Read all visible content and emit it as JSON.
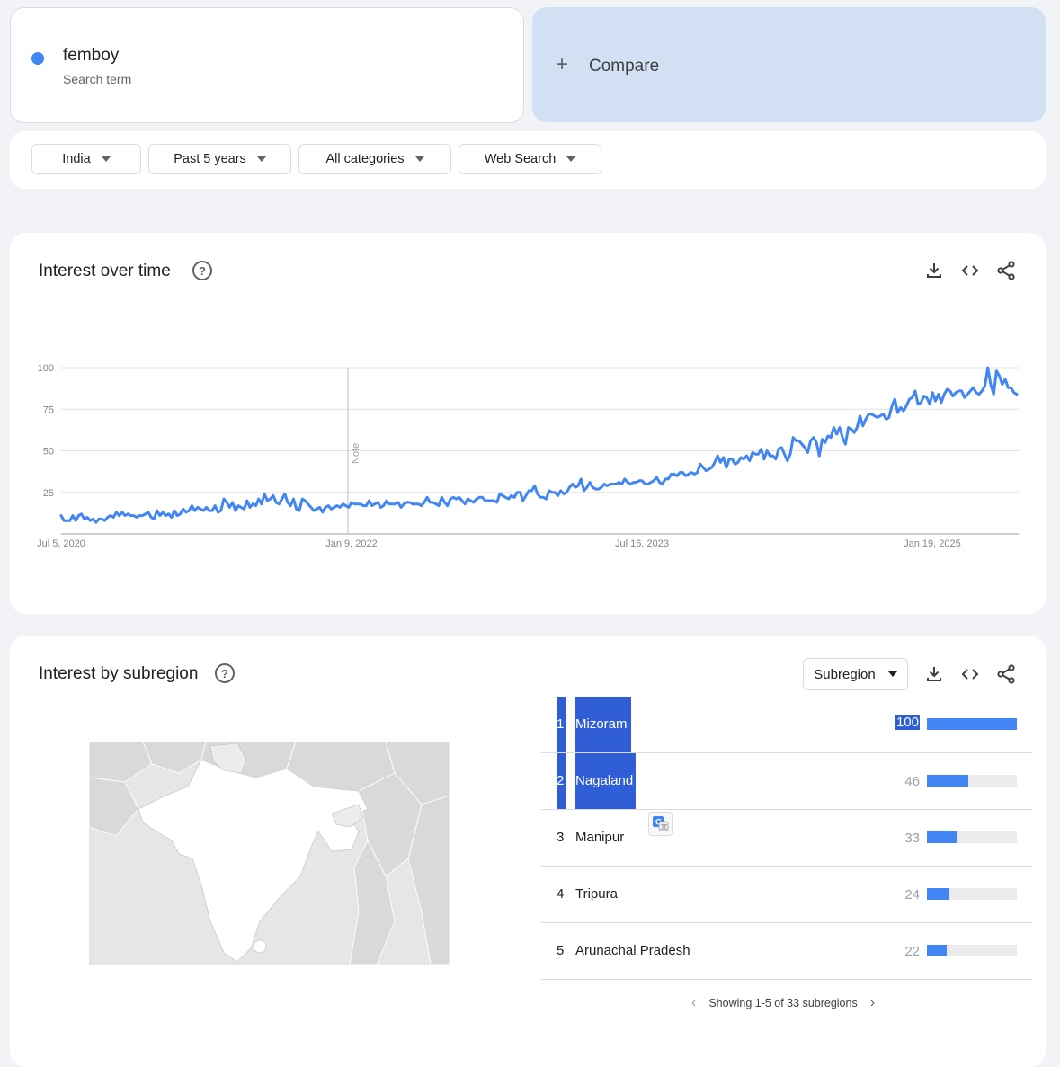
{
  "search_term": {
    "name": "femboy",
    "type": "Search term",
    "color": "#4285f4"
  },
  "compare": {
    "label": "Compare"
  },
  "filters": {
    "region": "India",
    "time_range": "Past 5 years",
    "category": "All categories",
    "search_type": "Web Search"
  },
  "time_section": {
    "title": "Interest over time",
    "note_label": "Note"
  },
  "chart_data": {
    "type": "line",
    "title": "",
    "xlabel": "",
    "ylabel": "",
    "ylim": [
      0,
      100
    ],
    "y_ticks": [
      25,
      50,
      75,
      100
    ],
    "x_tick_labels": [
      "Jul 5, 2020",
      "Jan 9, 2022",
      "Jul 16, 2023",
      "Jan 19, 2025"
    ],
    "x_start": "2020-07-05",
    "x_end": "2025-06-29",
    "x_tick_dates": [
      "2020-07-05",
      "2022-01-09",
      "2023-07-16",
      "2025-01-19"
    ],
    "note_date": "2022-01-02",
    "grid": true,
    "color": "#4285f4",
    "series": [
      {
        "values": [
          11,
          8,
          8,
          8,
          11,
          8,
          11,
          12,
          9,
          10,
          8,
          9,
          7,
          9,
          9,
          8,
          10,
          11,
          10,
          13,
          11,
          13,
          11,
          12,
          11,
          11,
          10,
          11,
          11,
          12,
          13,
          10,
          9,
          14,
          11,
          13,
          11,
          12,
          10,
          14,
          11,
          12,
          15,
          13,
          14,
          17,
          14,
          16,
          15,
          14,
          16,
          14,
          14,
          17,
          13,
          14,
          21,
          19,
          16,
          19,
          14,
          17,
          16,
          15,
          20,
          16,
          18,
          17,
          21,
          18,
          24,
          20,
          21,
          23,
          19,
          18,
          21,
          24,
          19,
          17,
          21,
          15,
          14,
          21,
          20,
          18,
          16,
          14,
          15,
          16,
          13,
          16,
          17,
          15,
          16,
          17,
          16,
          18,
          17,
          16,
          19,
          18,
          18,
          18,
          17,
          17,
          20,
          17,
          18,
          19,
          16,
          17,
          20,
          18,
          18,
          18,
          19,
          16,
          18,
          19,
          19,
          18,
          18,
          18,
          17,
          19,
          22,
          19,
          19,
          18,
          17,
          22,
          19,
          17,
          21,
          22,
          21,
          22,
          20,
          18,
          21,
          20,
          19,
          21,
          22,
          22,
          20,
          20,
          20,
          20,
          19,
          24,
          23,
          22,
          21,
          23,
          22,
          25,
          25,
          20,
          23,
          26,
          26,
          29,
          24,
          22,
          22,
          21,
          26,
          25,
          25,
          23,
          26,
          24,
          25,
          28,
          30,
          28,
          29,
          33,
          26,
          28,
          31,
          28,
          27,
          27,
          28,
          30,
          29,
          30,
          30,
          30,
          31,
          30,
          33,
          31,
          30,
          31,
          31,
          32,
          32,
          30,
          30,
          31,
          32,
          34,
          31,
          30,
          33,
          33,
          36,
          36,
          35,
          37,
          37,
          35,
          36,
          37,
          36,
          37,
          42,
          40,
          38,
          39,
          40,
          43,
          47,
          43,
          46,
          40,
          45,
          45,
          42,
          43,
          46,
          45,
          47,
          44,
          49,
          48,
          48,
          51,
          45,
          50,
          47,
          47,
          45,
          51,
          52,
          48,
          44,
          48,
          58,
          56,
          56,
          54,
          52,
          49,
          56,
          58,
          55,
          47,
          57,
          55,
          59,
          58,
          64,
          60,
          64,
          58,
          54,
          64,
          63,
          61,
          64,
          71,
          65,
          69,
          72,
          72,
          71,
          70,
          71,
          72,
          69,
          70,
          77,
          81,
          73,
          76,
          74,
          77,
          81,
          82,
          86,
          78,
          79,
          83,
          82,
          78,
          85,
          80,
          84,
          79,
          84,
          87,
          86,
          83,
          85,
          86,
          86,
          82,
          84,
          86,
          88,
          85,
          84,
          86,
          89,
          100,
          90,
          84,
          98,
          95,
          90,
          93,
          88,
          88,
          85,
          84
        ]
      }
    ]
  },
  "region_section": {
    "title": "Interest by subregion",
    "resolution": "Subregion",
    "rows": [
      {
        "rank": "1",
        "name": "Mizoram",
        "value": "100",
        "level": 100
      },
      {
        "rank": "2",
        "name": "Nagaland",
        "value": "46",
        "level": 46
      },
      {
        "rank": "3",
        "name": "Manipur",
        "value": "33",
        "level": 33
      },
      {
        "rank": "4",
        "name": "Tripura",
        "value": "24",
        "level": 24
      },
      {
        "rank": "5",
        "name": "Arunachal Pradesh",
        "value": "22",
        "level": 22
      }
    ],
    "pagination": "Showing 1-5 of 33 subregions"
  },
  "icons": {
    "download": "download-icon",
    "embed": "embed-code-icon",
    "share": "share-icon",
    "help": "help-circle-icon",
    "translate": "google-translate-icon"
  }
}
